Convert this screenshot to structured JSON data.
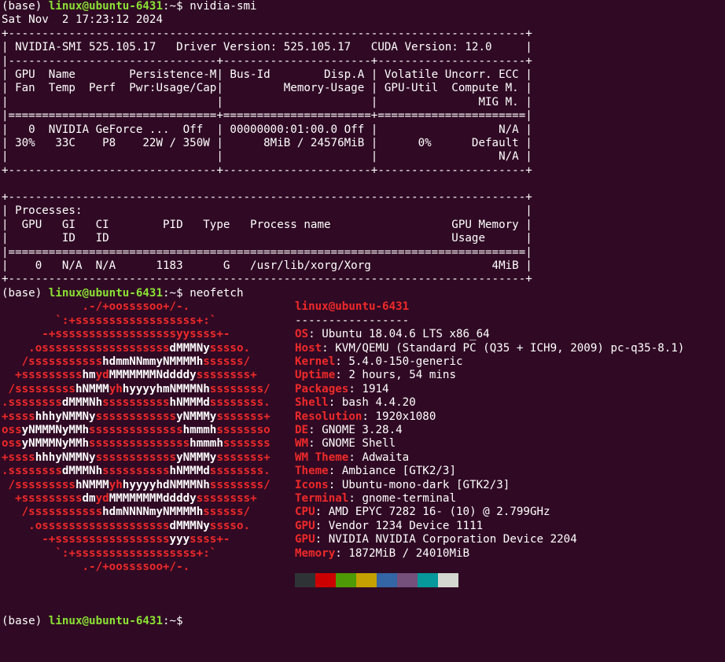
{
  "prompt": {
    "env": "(base) ",
    "user_host": "linux@ubuntu-6431",
    "cwd": ":~$ "
  },
  "commands": {
    "nvidia": "nvidia-smi",
    "neofetch": "neofetch"
  },
  "date_line": "Sat Nov  2 17:23:12 2024",
  "smi_table": [
    "+-----------------------------------------------------------------------------+",
    "| NVIDIA-SMI 525.105.17   Driver Version: 525.105.17   CUDA Version: 12.0     |",
    "|-------------------------------+----------------------+----------------------+",
    "| GPU  Name        Persistence-M| Bus-Id        Disp.A | Volatile Uncorr. ECC |",
    "| Fan  Temp  Perf  Pwr:Usage/Cap|         Memory-Usage | GPU-Util  Compute M. |",
    "|                               |                      |               MIG M. |",
    "|===============================+======================+======================|",
    "|   0  NVIDIA GeForce ...  Off  | 00000000:01:00.0 Off |                  N/A |",
    "| 30%   33C    P8    22W / 350W |      8MiB / 24576MiB |      0%      Default |",
    "|                               |                      |                  N/A |",
    "+-------------------------------+----------------------+----------------------+"
  ],
  "proc_table": [
    "+-----------------------------------------------------------------------------+",
    "| Processes:                                                                  |",
    "|  GPU   GI   CI        PID   Type   Process name                  GPU Memory |",
    "|        ID   ID                                                   Usage      |",
    "|=============================================================================|",
    "|    0   N/A  N/A      1183      G   /usr/lib/xorg/Xorg                  4MiB |",
    "+-----------------------------------------------------------------------------+"
  ],
  "neofetch": {
    "title": "linux@ubuntu-6431",
    "underline": "-----------------",
    "info": [
      {
        "key": "OS",
        "value": "Ubuntu 18.04.6 LTS x86_64"
      },
      {
        "key": "Host",
        "value": "KVM/QEMU (Standard PC (Q35 + ICH9, 2009) pc-q35-8.1)"
      },
      {
        "key": "Kernel",
        "value": "5.4.0-150-generic"
      },
      {
        "key": "Uptime",
        "value": "2 hours, 54 mins"
      },
      {
        "key": "Packages",
        "value": "1914"
      },
      {
        "key": "Shell",
        "value": "bash 4.4.20"
      },
      {
        "key": "Resolution",
        "value": "1920x1080"
      },
      {
        "key": "DE",
        "value": "GNOME 3.28.4"
      },
      {
        "key": "WM",
        "value": "GNOME Shell"
      },
      {
        "key": "WM Theme",
        "value": "Adwaita"
      },
      {
        "key": "Theme",
        "value": "Ambiance [GTK2/3]"
      },
      {
        "key": "Icons",
        "value": "Ubuntu-mono-dark [GTK2/3]"
      },
      {
        "key": "Terminal",
        "value": "gnome-terminal"
      },
      {
        "key": "CPU",
        "value": "AMD EPYC 7282 16- (10) @ 2.799GHz"
      },
      {
        "key": "GPU",
        "value": "Vendor 1234 Device 1111"
      },
      {
        "key": "GPU",
        "value": "NVIDIA NVIDIA Corporation Device 2204"
      },
      {
        "key": "Memory",
        "value": "1872MiB / 24010MiB"
      }
    ],
    "logo": [
      [
        [
          "            .-/+oossssoo+/-.",
          "r"
        ]
      ],
      [
        [
          "        `:+ssssssssssssssssss+:`",
          "r"
        ]
      ],
      [
        [
          "      -+ssssssssssssssssssyyssss+-",
          "r"
        ]
      ],
      [
        [
          "    .osssssssssssssssssss",
          "r"
        ],
        [
          "dMMMNy",
          "w"
        ],
        [
          "sssso.",
          "r"
        ]
      ],
      [
        [
          "   /sssssssssss",
          "r"
        ],
        [
          "hdmmNNmmyNMMMMh",
          "w"
        ],
        [
          "ssssss/",
          "r"
        ]
      ],
      [
        [
          "  +sssssssss",
          "r"
        ],
        [
          "hm",
          "w"
        ],
        [
          "yd",
          "r"
        ],
        [
          "MMMMMMMNddddy",
          "w"
        ],
        [
          "ssssssss+",
          "r"
        ]
      ],
      [
        [
          " /sssssssss",
          "r"
        ],
        [
          "hNMMM",
          "w"
        ],
        [
          "yh",
          "r"
        ],
        [
          "hyyyyhmNMMMNh",
          "w"
        ],
        [
          "ssssssss/",
          "r"
        ]
      ],
      [
        [
          ".ssssssss",
          "r"
        ],
        [
          "dMMMNh",
          "w"
        ],
        [
          "ssssssssss",
          "r"
        ],
        [
          "hNMMMd",
          "w"
        ],
        [
          "ssssssss.",
          "r"
        ]
      ],
      [
        [
          "+ssss",
          "r"
        ],
        [
          "hhhyNMMNy",
          "w"
        ],
        [
          "ssssssssssss",
          "r"
        ],
        [
          "yNMMMy",
          "w"
        ],
        [
          "sssssss+",
          "r"
        ]
      ],
      [
        [
          "oss",
          "r"
        ],
        [
          "yNMMMNyMMh",
          "w"
        ],
        [
          "ssssssssssssss",
          "r"
        ],
        [
          "hmmmh",
          "w"
        ],
        [
          "ssssssso",
          "r"
        ]
      ],
      [
        [
          "oss",
          "r"
        ],
        [
          "yNMMMNyMMh",
          "w"
        ],
        [
          "sssssssssssssss",
          "r"
        ],
        [
          "hmmmh",
          "w"
        ],
        [
          "sssssss",
          "r"
        ]
      ],
      [
        [
          "+ssss",
          "r"
        ],
        [
          "hhhyNMMNy",
          "w"
        ],
        [
          "ssssssssssss",
          "r"
        ],
        [
          "yNMMMy",
          "w"
        ],
        [
          "sssssss+",
          "r"
        ]
      ],
      [
        [
          ".ssssssss",
          "r"
        ],
        [
          "dMMMNh",
          "w"
        ],
        [
          "ssssssssss",
          "r"
        ],
        [
          "hNMMMd",
          "w"
        ],
        [
          "ssssssss.",
          "r"
        ]
      ],
      [
        [
          " /sssssssss",
          "r"
        ],
        [
          "hNMMM",
          "w"
        ],
        [
          "yh",
          "r"
        ],
        [
          "hyyyyhdNMMMNh",
          "w"
        ],
        [
          "ssssssss/",
          "r"
        ]
      ],
      [
        [
          "  +sssssssss",
          "r"
        ],
        [
          "dm",
          "w"
        ],
        [
          "yd",
          "r"
        ],
        [
          "MMMMMMMMddddy",
          "w"
        ],
        [
          "ssssssss+",
          "r"
        ]
      ],
      [
        [
          "   /sssssssssss",
          "r"
        ],
        [
          "hdmNNNNmyNMMMMh",
          "w"
        ],
        [
          "ssssss/",
          "r"
        ]
      ],
      [
        [
          "    .osssssssssssssssssss",
          "r"
        ],
        [
          "dMMMNy",
          "w"
        ],
        [
          "sssso.",
          "r"
        ]
      ],
      [
        [
          "      -+sssssssssssssssss",
          "r"
        ],
        [
          "yyy",
          "w"
        ],
        [
          "ssss+-",
          "r"
        ]
      ],
      [
        [
          "        `:+ssssssssssssssssss+:`",
          "r"
        ]
      ],
      [
        [
          "            .-/+oossssoo+/-.",
          "r"
        ]
      ]
    ],
    "palette": [
      "#2e3436",
      "#cc0000",
      "#4e9a06",
      "#c4a000",
      "#3465a4",
      "#75507b",
      "#06989a",
      "#d3d7cf"
    ]
  }
}
